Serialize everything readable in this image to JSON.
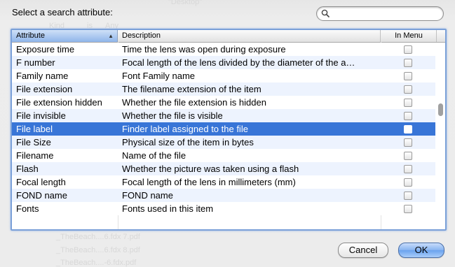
{
  "dialog": {
    "prompt": "Select a search attribute:",
    "search": {
      "value": "",
      "placeholder": ""
    }
  },
  "background_ghost": {
    "top_label": "\"Desktop\"",
    "top_row_1": "Kind",
    "top_row_2": "is",
    "top_row_3": "Any",
    "files": [
      "_TheBeach....6.fdx 7.pdf",
      "_TheBeach....6.fdx 8.pdf",
      "_TheBeach....-6.fdx.pdf"
    ]
  },
  "table": {
    "columns": {
      "attribute": "Attribute",
      "description": "Description",
      "in_menu": "In Menu"
    },
    "sort": {
      "column": "Attribute",
      "direction": "ascending"
    },
    "selected_index": 6,
    "rows": [
      {
        "attribute": "Exposure time",
        "description": "Time the lens was open during exposure",
        "in_menu": false
      },
      {
        "attribute": "F number",
        "description": "Focal length of the lens divided by the diameter of the a…",
        "in_menu": false
      },
      {
        "attribute": "Family name",
        "description": "Font Family name",
        "in_menu": false
      },
      {
        "attribute": "File extension",
        "description": "The filename extension of the item",
        "in_menu": false
      },
      {
        "attribute": "File extension hidden",
        "description": "Whether the file extension is hidden",
        "in_menu": false
      },
      {
        "attribute": "File invisible",
        "description": "Whether the file is visible",
        "in_menu": false
      },
      {
        "attribute": "File label",
        "description": "Finder label assigned to the file",
        "in_menu": false
      },
      {
        "attribute": "File Size",
        "description": "Physical size of the item in bytes",
        "in_menu": false
      },
      {
        "attribute": "Filename",
        "description": "Name of the file",
        "in_menu": false
      },
      {
        "attribute": "Flash",
        "description": "Whether the picture was taken using a flash",
        "in_menu": false
      },
      {
        "attribute": "Focal length",
        "description": "Focal length of the lens in millimeters (mm)",
        "in_menu": false
      },
      {
        "attribute": "FOND name",
        "description": "FOND name",
        "in_menu": false
      },
      {
        "attribute": "Fonts",
        "description": "Fonts used in this item",
        "in_menu": false
      }
    ]
  },
  "buttons": {
    "cancel": "Cancel",
    "ok": "OK"
  },
  "colors": {
    "selection": "#3875d7",
    "alt_row": "#edf3fe",
    "focus_ring": "#7aa0d8"
  }
}
